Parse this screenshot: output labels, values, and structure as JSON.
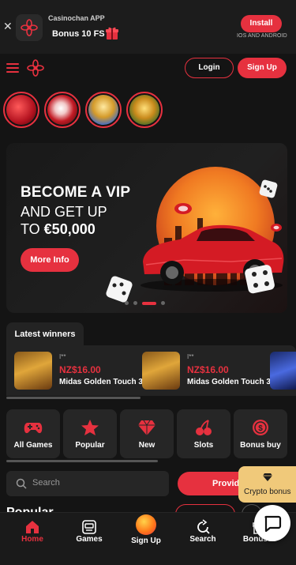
{
  "app_banner": {
    "close_icon": "close-icon",
    "app_name": "Casinochan APP",
    "bonus_text": "Bonus 10 FS",
    "install_label": "Install",
    "platforms_text": "IOS AND ANDROID"
  },
  "header": {
    "login_label": "Login",
    "signup_label": "Sign Up"
  },
  "stories": [
    "dice-story",
    "megaphone-story",
    "gods-story",
    "temple-story"
  ],
  "hero": {
    "line1": "BECOME A VIP",
    "line2": "AND GET UP",
    "line3_prefix": "TO ",
    "line3_amount": "€50,000",
    "more_info_label": "More Info",
    "slides_count": 4,
    "active_slide": 3
  },
  "winners": {
    "tab_label": "Latest winners",
    "items": [
      {
        "user": "I**",
        "amount": "NZ$16.00",
        "game": "Midas Golden Touch 3"
      },
      {
        "user": "I**",
        "amount": "NZ$16.00",
        "game": "Midas Golden Touch 3"
      }
    ]
  },
  "categories": [
    {
      "label": "All Games",
      "icon": "gamepad-icon"
    },
    {
      "label": "Popular",
      "icon": "star-icon"
    },
    {
      "label": "New",
      "icon": "diamond-icon"
    },
    {
      "label": "Slots",
      "icon": "cherry-icon"
    },
    {
      "label": "Bonus buy",
      "icon": "coin-icon"
    }
  ],
  "search": {
    "placeholder": "Search",
    "providers_label": "Provid"
  },
  "popular_title": "Popular",
  "crypto_bonus": {
    "label": "Crypto bonus",
    "icon": "diamond-icon"
  },
  "bottom_nav": [
    {
      "label": "Home",
      "icon": "home-icon",
      "active": true
    },
    {
      "label": "Games",
      "icon": "slot-machine-icon",
      "active": false
    },
    {
      "label": "Sign Up",
      "icon": "signup-icon",
      "active": false
    },
    {
      "label": "Search",
      "icon": "search-icon",
      "active": false
    },
    {
      "label": "Bonuses",
      "icon": "gift-icon",
      "active": false
    }
  ],
  "colors": {
    "accent": "#e6313f",
    "background": "#141414",
    "card": "#262626",
    "crypto": "#f0c97a"
  }
}
